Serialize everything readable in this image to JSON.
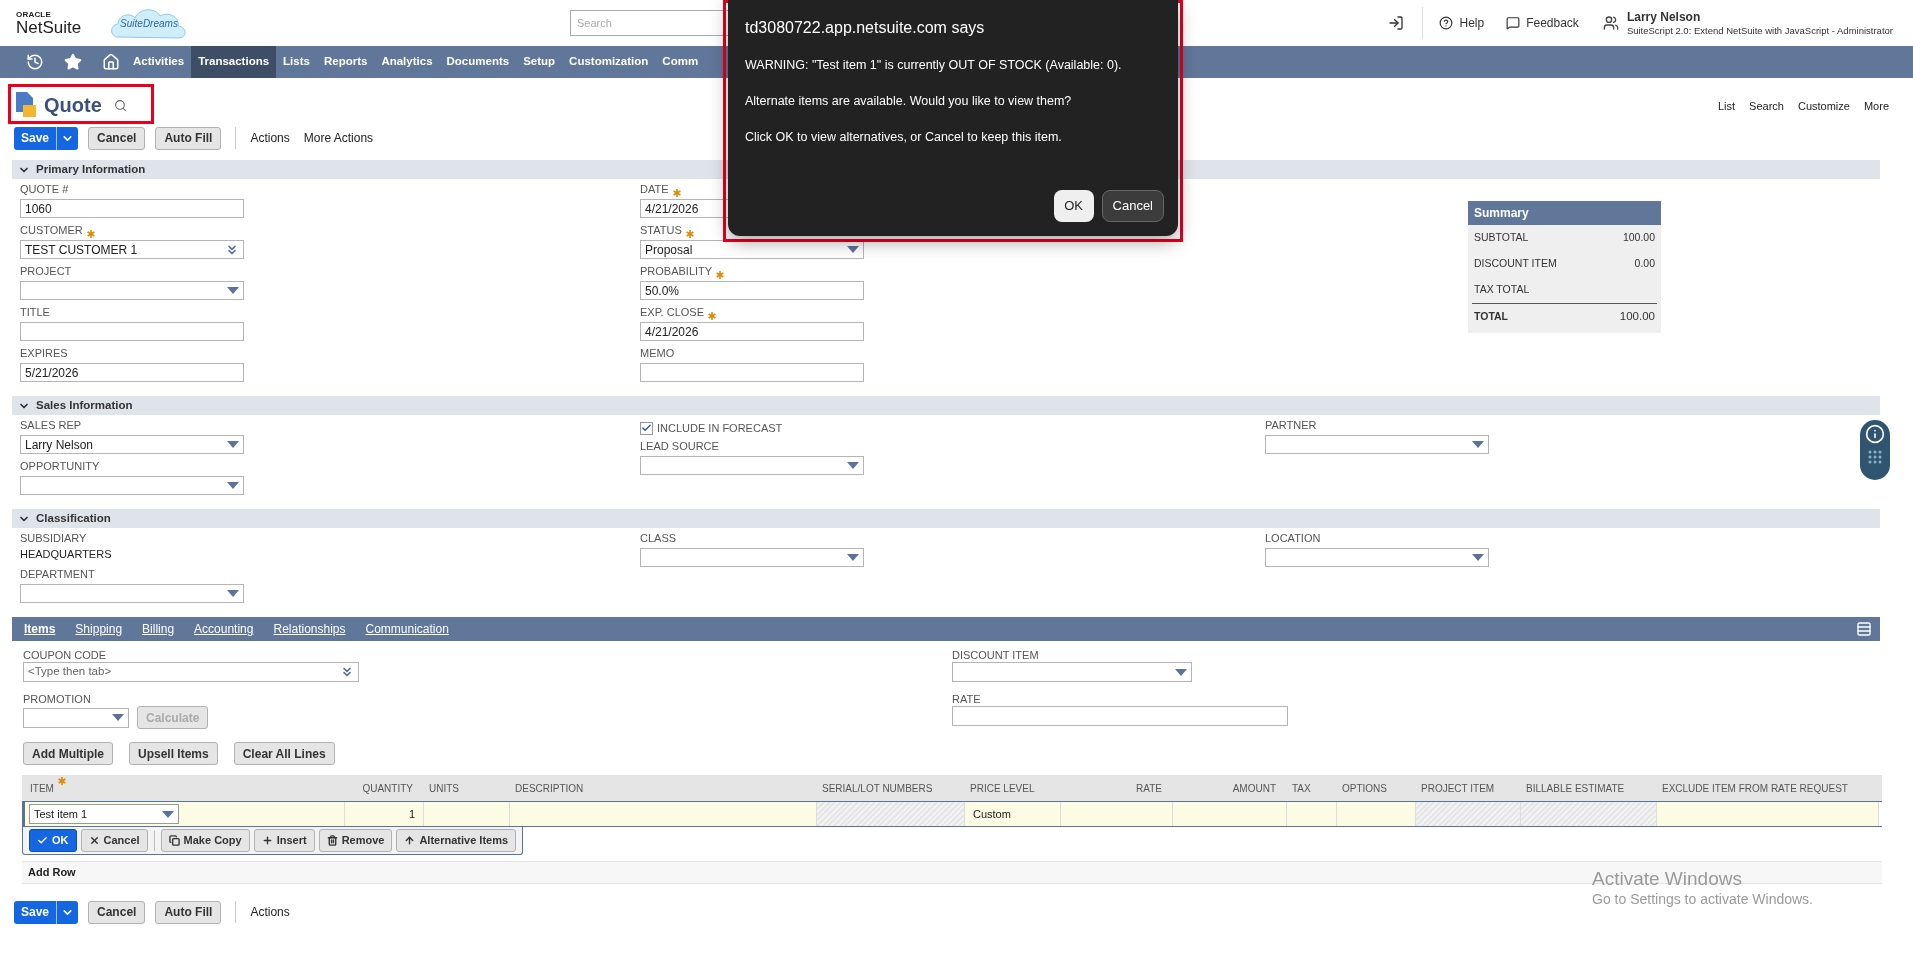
{
  "header": {
    "logo_small": "ORACLE",
    "logo": "NetSuite",
    "badge": "SuiteDreams",
    "search_placeholder": "Search",
    "help": "Help",
    "feedback": "Feedback",
    "user_name": "Larry Nelson",
    "user_role": "SuiteScript 2.0: Extend NetSuite with JavaScript - Administrator"
  },
  "nav": [
    {
      "label": "Activities",
      "selected": false
    },
    {
      "label": "Transactions",
      "selected": true
    },
    {
      "label": "Lists",
      "selected": false
    },
    {
      "label": "Reports",
      "selected": false
    },
    {
      "label": "Analytics",
      "selected": false
    },
    {
      "label": "Documents",
      "selected": false
    },
    {
      "label": "Setup",
      "selected": false
    },
    {
      "label": "Customization",
      "selected": false
    },
    {
      "label": "Comm",
      "selected": false
    }
  ],
  "page": {
    "title": "Quote",
    "links": [
      "List",
      "Search",
      "Customize",
      "More"
    ]
  },
  "toolbar": {
    "save": "Save",
    "cancel": "Cancel",
    "auto_fill": "Auto Fill",
    "actions": [
      "Actions",
      "More Actions"
    ]
  },
  "sections": [
    {
      "title": "Primary Information",
      "expanded": true,
      "columns": [
        [
          {
            "label": "QUOTE #",
            "kind": "text",
            "required": false,
            "value": "1060"
          },
          {
            "label": "CUSTOMER",
            "kind": "combo",
            "required": true,
            "value": "TEST CUSTOMER 1"
          },
          {
            "label": "PROJECT",
            "kind": "select",
            "required": false
          },
          {
            "label": "TITLE",
            "kind": "text",
            "required": false
          },
          {
            "label": "EXPIRES",
            "kind": "text",
            "required": false,
            "value": "5/21/2026"
          }
        ],
        [
          {
            "label": "DATE",
            "kind": "text",
            "required": true,
            "value": "4/21/2026"
          },
          {
            "label": "STATUS",
            "kind": "select",
            "required": true,
            "value": "Proposal"
          },
          {
            "label": "PROBABILITY",
            "kind": "text",
            "required": true,
            "value": "50.0%"
          },
          {
            "label": "EXP. CLOSE",
            "kind": "text",
            "required": true,
            "value": "4/21/2026"
          },
          {
            "label": "MEMO",
            "kind": "text",
            "required": false
          }
        ],
        []
      ]
    },
    {
      "title": "Sales Information",
      "expanded": true,
      "columns": [
        [
          {
            "label": "SALES REP",
            "kind": "select",
            "required": false,
            "value": "Larry Nelson"
          },
          {
            "label": "OPPORTUNITY",
            "kind": "select",
            "required": false
          }
        ],
        [
          {
            "label": "INCLUDE IN FORECAST",
            "kind": "checkbox",
            "checked": true
          },
          {
            "label": "LEAD SOURCE",
            "kind": "select",
            "required": false
          }
        ],
        [
          {
            "label": "PARTNER",
            "kind": "select",
            "required": false
          }
        ]
      ]
    },
    {
      "title": "Classification",
      "expanded": true,
      "columns": [
        [
          {
            "label": "SUBSIDIARY",
            "kind": "static",
            "value": "HEADQUARTERS"
          },
          {
            "label": "DEPARTMENT",
            "kind": "select",
            "required": false
          }
        ],
        [
          {
            "label": "CLASS",
            "kind": "select",
            "required": false
          }
        ],
        [
          {
            "label": "LOCATION",
            "kind": "select",
            "required": false
          }
        ]
      ]
    }
  ],
  "summary": {
    "title": "Summary",
    "rows": [
      {
        "label": "SUBTOTAL",
        "value": "100.00",
        "kind": "line"
      },
      {
        "label": "DISCOUNT ITEM",
        "value": "0.00",
        "kind": "line"
      },
      {
        "label": "TAX TOTAL",
        "kind": "line"
      },
      {
        "label": "TOTAL",
        "value": "100.00",
        "kind": "total"
      }
    ]
  },
  "subtabs": [
    {
      "label": "Items",
      "selected": true
    },
    {
      "label": "Shipping",
      "selected": false
    },
    {
      "label": "Billing",
      "selected": false
    },
    {
      "label": "Accounting",
      "selected": false
    },
    {
      "label": "Relationships",
      "selected": false
    },
    {
      "label": "Communication",
      "selected": false
    }
  ],
  "items_form": {
    "coupon": {
      "label": "COUPON CODE",
      "placeholder": "<Type then tab>"
    },
    "promotion": {
      "label": "PROMOTION"
    },
    "calculate": {
      "label": "Calculate",
      "disabled": true
    },
    "discount_item": {
      "label": "DISCOUNT ITEM"
    },
    "rate": {
      "label": "RATE"
    }
  },
  "item_buttons": [
    "Add Multiple",
    "Upsell Items",
    "Clear All Lines"
  ],
  "table": {
    "columns": [
      {
        "label": "ITEM",
        "required": true,
        "kind": "text"
      },
      {
        "label": "QUANTITY",
        "required": false,
        "kind": "number"
      },
      {
        "label": "UNITS",
        "required": false,
        "kind": "text"
      },
      {
        "label": "DESCRIPTION",
        "required": false,
        "kind": "text"
      },
      {
        "label": "SERIAL/LOT NUMBERS",
        "required": false,
        "kind": "text"
      },
      {
        "label": "PRICE LEVEL",
        "required": false,
        "kind": "text"
      },
      {
        "label": "RATE",
        "required": false,
        "kind": "number"
      },
      {
        "label": "AMOUNT",
        "required": false,
        "kind": "number"
      },
      {
        "label": "TAX",
        "required": false,
        "kind": "text"
      },
      {
        "label": "OPTIONS",
        "required": false,
        "kind": "text"
      },
      {
        "label": "PROJECT ITEM",
        "required": false,
        "kind": "text"
      },
      {
        "label": "BILLABLE ESTIMATE",
        "required": false,
        "kind": "text"
      },
      {
        "label": "EXCLUDE ITEM FROM RATE REQUEST",
        "required": false,
        "kind": "text"
      }
    ],
    "row": [
      {
        "kind": "select",
        "value": "Test item 1"
      },
      {
        "kind": "input",
        "value": "1"
      },
      {
        "kind": "input"
      },
      {
        "kind": "input"
      },
      {
        "kind": "disabled"
      },
      {
        "kind": "input",
        "value": "Custom"
      },
      {
        "kind": "input"
      },
      {
        "kind": "input"
      },
      {
        "kind": "input"
      },
      {
        "kind": "input"
      },
      {
        "kind": "disabled"
      },
      {
        "kind": "disabled"
      },
      {
        "kind": "input"
      }
    ]
  },
  "row_actions": [
    {
      "label": "OK",
      "primary": true
    },
    {
      "label": "Cancel",
      "primary": false
    },
    {
      "label": "Make Copy",
      "primary": false
    },
    {
      "label": "Insert",
      "primary": false
    },
    {
      "label": "Remove",
      "primary": false
    },
    {
      "label": "Alternative Items",
      "primary": false
    }
  ],
  "add_row": "Add Row",
  "bottom_toolbar": {
    "save": "Save",
    "cancel": "Cancel",
    "auto_fill": "Auto Fill",
    "actions": [
      "Actions"
    ]
  },
  "dialog": {
    "title": "td3080722.app.netsuite.com says",
    "lines": [
      "WARNING: \"Test item 1\" is currently OUT OF STOCK (Available: 0).",
      "Alternate items are available. Would you like to view them?",
      "Click OK to view alternatives, or Cancel to keep this item."
    ],
    "buttons": [
      {
        "label": "OK",
        "kind": "default"
      },
      {
        "label": "Cancel",
        "kind": "secondary"
      }
    ]
  },
  "os_overlay": {
    "title": "Activate Windows",
    "subtitle": "Go to Settings to activate Windows."
  }
}
